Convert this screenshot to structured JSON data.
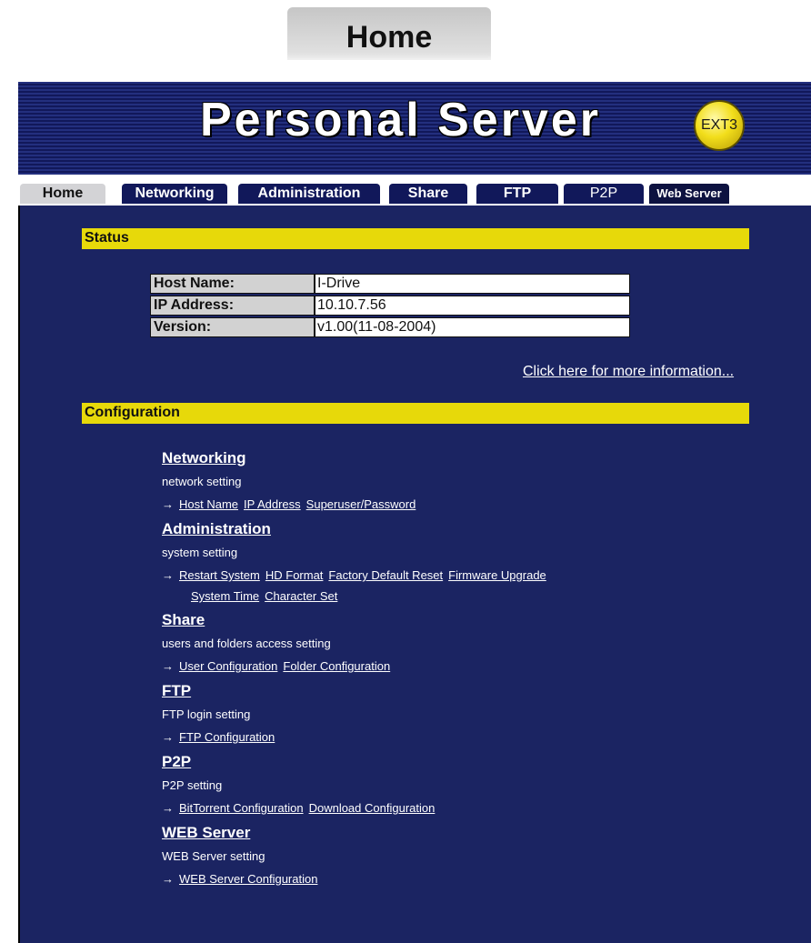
{
  "page_caption": "Home",
  "banner": {
    "title": "Personal Server",
    "badge": "EXT3"
  },
  "nav": {
    "tabs": [
      "Home",
      "Networking",
      "Administration",
      "Share",
      "FTP",
      "P2P",
      "Web Server"
    ],
    "active": "Home"
  },
  "status": {
    "heading": "Status",
    "rows": [
      {
        "label": "Host Name:",
        "value": "I-Drive"
      },
      {
        "label": "IP Address:",
        "value": "10.10.7.56"
      },
      {
        "label": "Version:",
        "value": "v1.00(11-08-2004)"
      }
    ],
    "more_link": "Click here for more information..."
  },
  "configuration": {
    "heading": "Configuration",
    "arrow": "→",
    "sections": [
      {
        "title": "Networking",
        "desc": "network setting",
        "links": [
          "Host Name",
          "IP Address",
          "Superuser/Password"
        ],
        "links2": []
      },
      {
        "title": "Administration",
        "desc": "system setting",
        "links": [
          "Restart System",
          "HD Format",
          "Factory Default Reset",
          "Firmware Upgrade"
        ],
        "links2": [
          "System Time",
          "Character Set"
        ]
      },
      {
        "title": "Share",
        "desc": "users and folders access setting",
        "links": [
          "User Configuration",
          "Folder Configuration"
        ],
        "links2": []
      },
      {
        "title": "FTP",
        "desc": "FTP login setting",
        "links": [
          "FTP Configuration"
        ],
        "links2": []
      },
      {
        "title": "P2P",
        "desc": "P2P setting",
        "links": [
          "BitTorrent Configuration",
          "Download Configuration"
        ],
        "links2": []
      },
      {
        "title": "WEB Server",
        "desc": "WEB Server setting",
        "links": [
          "WEB Server Configuration"
        ],
        "links2": []
      }
    ]
  },
  "colors": {
    "panel": "#1b2462",
    "section_bar": "#e7d90a",
    "tab": "#11185a",
    "tab_active": "#d3d3d6"
  }
}
